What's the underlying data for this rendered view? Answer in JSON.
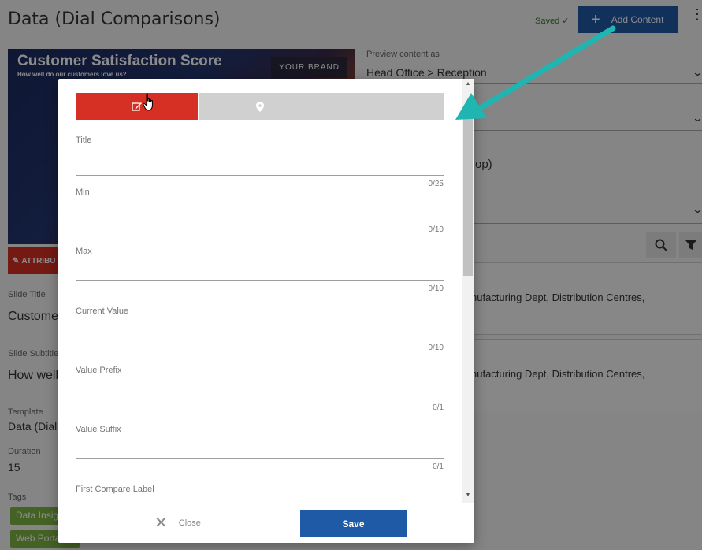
{
  "page": {
    "title": "Data (Dial Comparisons)",
    "saved_label": "Saved ✓",
    "add_content_label": "Add Content",
    "preview": {
      "title": "Customer Satisfaction Score",
      "subtitle": "How well do our customers love us?",
      "brand": "YOUR BRAND"
    },
    "attributes_label": "ATTRIBU",
    "slide_title_label": "Slide Title",
    "slide_title_value": "Custome",
    "slide_subtitle_label": "Slide Subtitle",
    "slide_subtitle_value": "How well",
    "template_label": "Template",
    "template_value": "Data (Dial",
    "duration_label": "Duration",
    "duration_value": "15",
    "tags_label": "Tags",
    "tags": [
      "Data Insig",
      "Web Porta"
    ],
    "preview_as_label": "Preview content as",
    "preview_as_value": "Head Office > Reception",
    "drop_text": "rop)",
    "card1_text": "nufacturing Dept, Distribution Centres,",
    "card2_text": "nufacturing Dept, Distribution Centres,"
  },
  "dialog": {
    "fields": [
      {
        "label": "Title",
        "counter": "0/25",
        "value": ""
      },
      {
        "label": "Min",
        "counter": "0/10",
        "value": ""
      },
      {
        "label": "Max",
        "counter": "0/10",
        "value": ""
      },
      {
        "label": "Current Value",
        "counter": "0/10",
        "value": ""
      },
      {
        "label": "Value Prefix",
        "counter": "0/1",
        "value": ""
      },
      {
        "label": "Value Suffix",
        "counter": "0/1",
        "value": ""
      },
      {
        "label": "First Compare Label"
      }
    ],
    "close_label": "Close",
    "save_label": "Save"
  },
  "colors": {
    "accent_red": "#d62f24",
    "primary_blue": "#1f5aa6",
    "arrow_teal": "#1fb5b0",
    "tag_green": "#7cb342"
  }
}
